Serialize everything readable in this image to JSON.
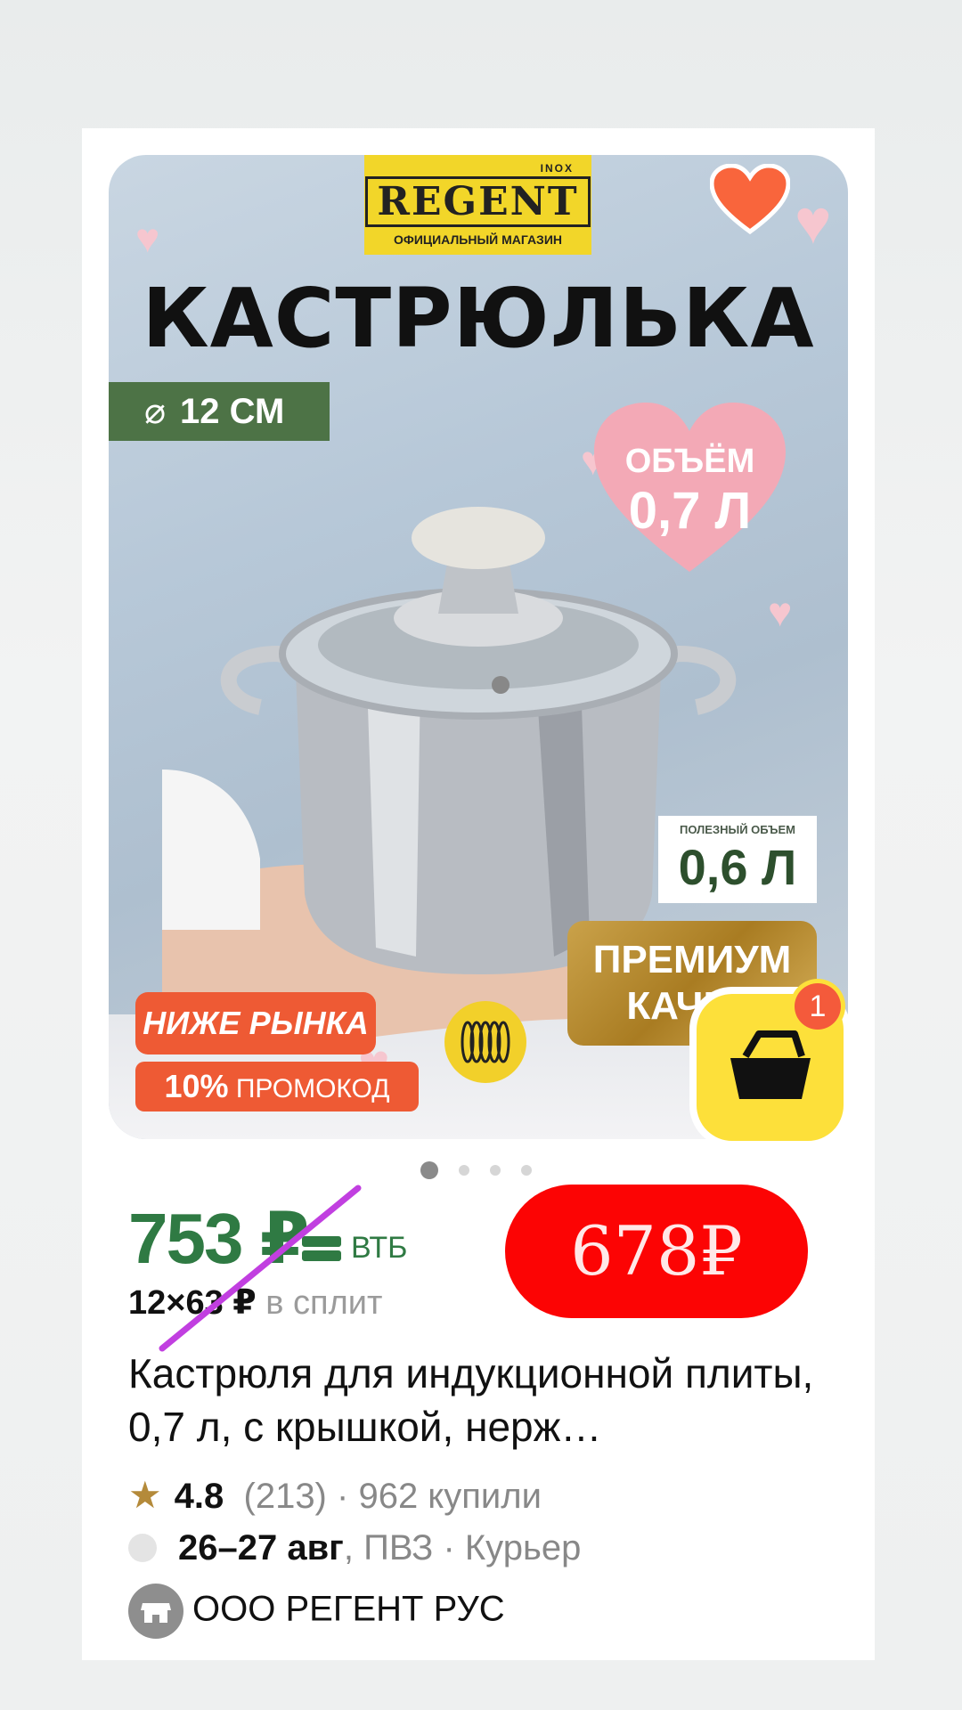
{
  "image": {
    "brand": "REGENT",
    "brand_suffix": "INOX",
    "brand_subtitle": "ОФИЦИАЛЬНЫЙ МАГАЗИН",
    "headline": "КАСТРЮЛЬКА",
    "size_label": "12 СМ",
    "volume_label": "ОБЪЁМ",
    "volume_value": "0,7 Л",
    "useful_volume_label": "ПОЛЕЗНЫЙ ОБЪЕМ",
    "useful_volume_value": "0,6 Л",
    "premium_line1": "ПРЕМИУМ",
    "premium_line2": "КАЧЕС",
    "below_market": "НИЖЕ РЫНКА",
    "promo_percent": "10%",
    "promo_text": "ПРОМОКОД",
    "carousel_dots": 4,
    "active_dot": 1
  },
  "cart": {
    "badge_count": "1"
  },
  "price": {
    "current": "753 ₽",
    "bank": "ВТБ",
    "split_amount": "12×63 ₽",
    "split_label": "в сплит",
    "sticker_price": "678₽"
  },
  "product": {
    "title": "Кастрюля для индукционной плиты, 0,7 л, с крышкой, нерж…",
    "rating": "4.8",
    "reviews": "(213)",
    "bought": "· 962 купили",
    "delivery_dates": "26–27 авг",
    "delivery_options": ", ПВЗ · Курьер",
    "seller": "ООО РЕГЕНТ РУС"
  },
  "colors": {
    "price_green": "#2f7a43",
    "sticker_red": "#fc0404",
    "cart_yellow": "#fde03a",
    "promo_orange": "#ee5a34",
    "favorite_heart": "#f9653c"
  }
}
